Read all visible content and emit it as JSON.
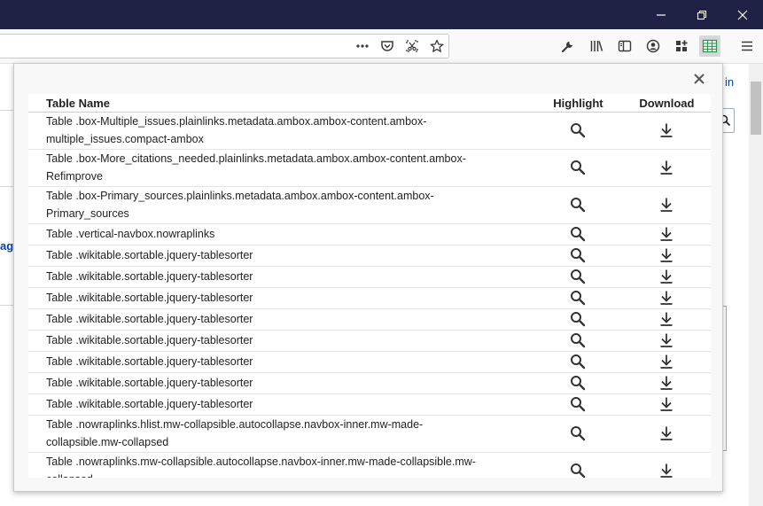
{
  "browser": {
    "url_actions": [
      "more-actions",
      "pocket",
      "screenshot",
      "bookmark-star"
    ],
    "toolbar_icons": [
      "wrench-icon",
      "library-icon",
      "sidebar-icon",
      "account-icon",
      "extensions-icon",
      "table-capture-icon",
      "menu-icon"
    ]
  },
  "page": {
    "edge_text_1": "in",
    "edge_text_2": "ag"
  },
  "popup": {
    "headers": {
      "name": "Table Name",
      "highlight": "Highlight",
      "download": "Download"
    },
    "rows": [
      {
        "name": "Table .box-Multiple_issues.plainlinks.metadata.ambox.ambox-content.ambox-multiple_issues.compact-ambox"
      },
      {
        "name": "Table .box-More_citations_needed.plainlinks.metadata.ambox.ambox-content.ambox-Refimprove"
      },
      {
        "name": "Table .box-Primary_sources.plainlinks.metadata.ambox.ambox-content.ambox-Primary_sources"
      },
      {
        "name": "Table .vertical-navbox.nowraplinks"
      },
      {
        "name": "Table .wikitable.sortable.jquery-tablesorter"
      },
      {
        "name": "Table .wikitable.sortable.jquery-tablesorter"
      },
      {
        "name": "Table .wikitable.sortable.jquery-tablesorter"
      },
      {
        "name": "Table .wikitable.sortable.jquery-tablesorter"
      },
      {
        "name": "Table .wikitable.sortable.jquery-tablesorter"
      },
      {
        "name": "Table .wikitable.sortable.jquery-tablesorter"
      },
      {
        "name": "Table .wikitable.sortable.jquery-tablesorter"
      },
      {
        "name": "Table .wikitable.sortable.jquery-tablesorter"
      },
      {
        "name": "Table .nowraplinks.hlist.mw-collapsible.autocollapse.navbox-inner.mw-made-collapsible.mw-collapsed"
      },
      {
        "name": "Table .nowraplinks.mw-collapsible.autocollapse.navbox-inner.mw-made-collapsible.mw-collapsed"
      }
    ]
  },
  "colors": {
    "titlebar": "#1f2244",
    "link": "#0645ad",
    "active_icon": "#2a9a4a"
  }
}
